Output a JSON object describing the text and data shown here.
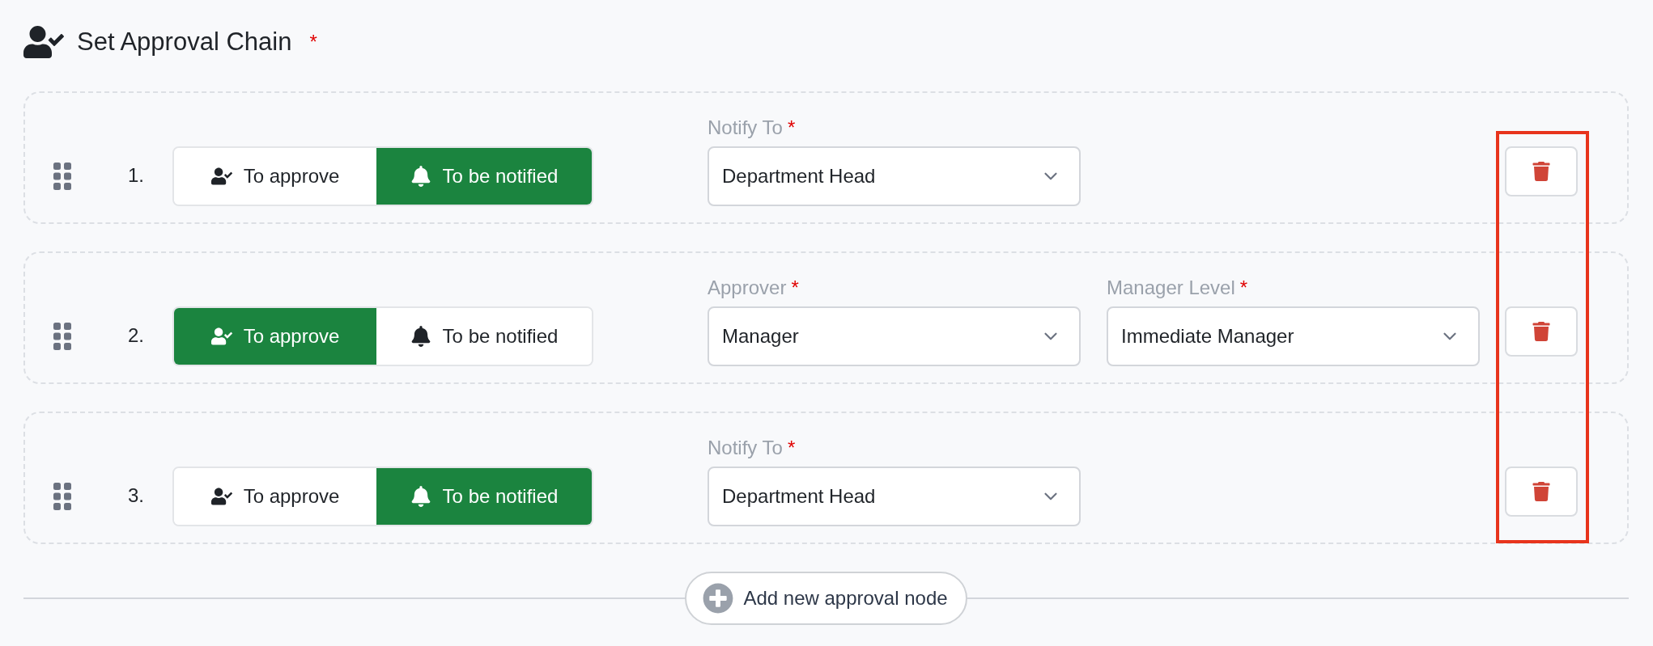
{
  "header": {
    "title": "Set Approval Chain",
    "required_mark": "*"
  },
  "nodes": [
    {
      "number": "1.",
      "toggles": [
        {
          "kind": "approve",
          "label": "To approve",
          "selected": false
        },
        {
          "kind": "notify",
          "label": "To be notified",
          "selected": true
        }
      ],
      "fields": [
        {
          "label": "Notify To",
          "required_mark": "*",
          "value": "Department Head"
        }
      ]
    },
    {
      "number": "2.",
      "toggles": [
        {
          "kind": "approve",
          "label": "To approve",
          "selected": true
        },
        {
          "kind": "notify",
          "label": "To be notified",
          "selected": false
        }
      ],
      "fields": [
        {
          "label": "Approver",
          "required_mark": "*",
          "value": "Manager"
        },
        {
          "label": "Manager Level",
          "required_mark": "*",
          "value": "Immediate Manager"
        }
      ]
    },
    {
      "number": "3.",
      "toggles": [
        {
          "kind": "approve",
          "label": "To approve",
          "selected": false
        },
        {
          "kind": "notify",
          "label": "To be notified",
          "selected": true
        }
      ],
      "fields": [
        {
          "label": "Notify To",
          "required_mark": "*",
          "value": "Department Head"
        }
      ]
    }
  ],
  "add_button": {
    "label": "Add new approval node"
  }
}
